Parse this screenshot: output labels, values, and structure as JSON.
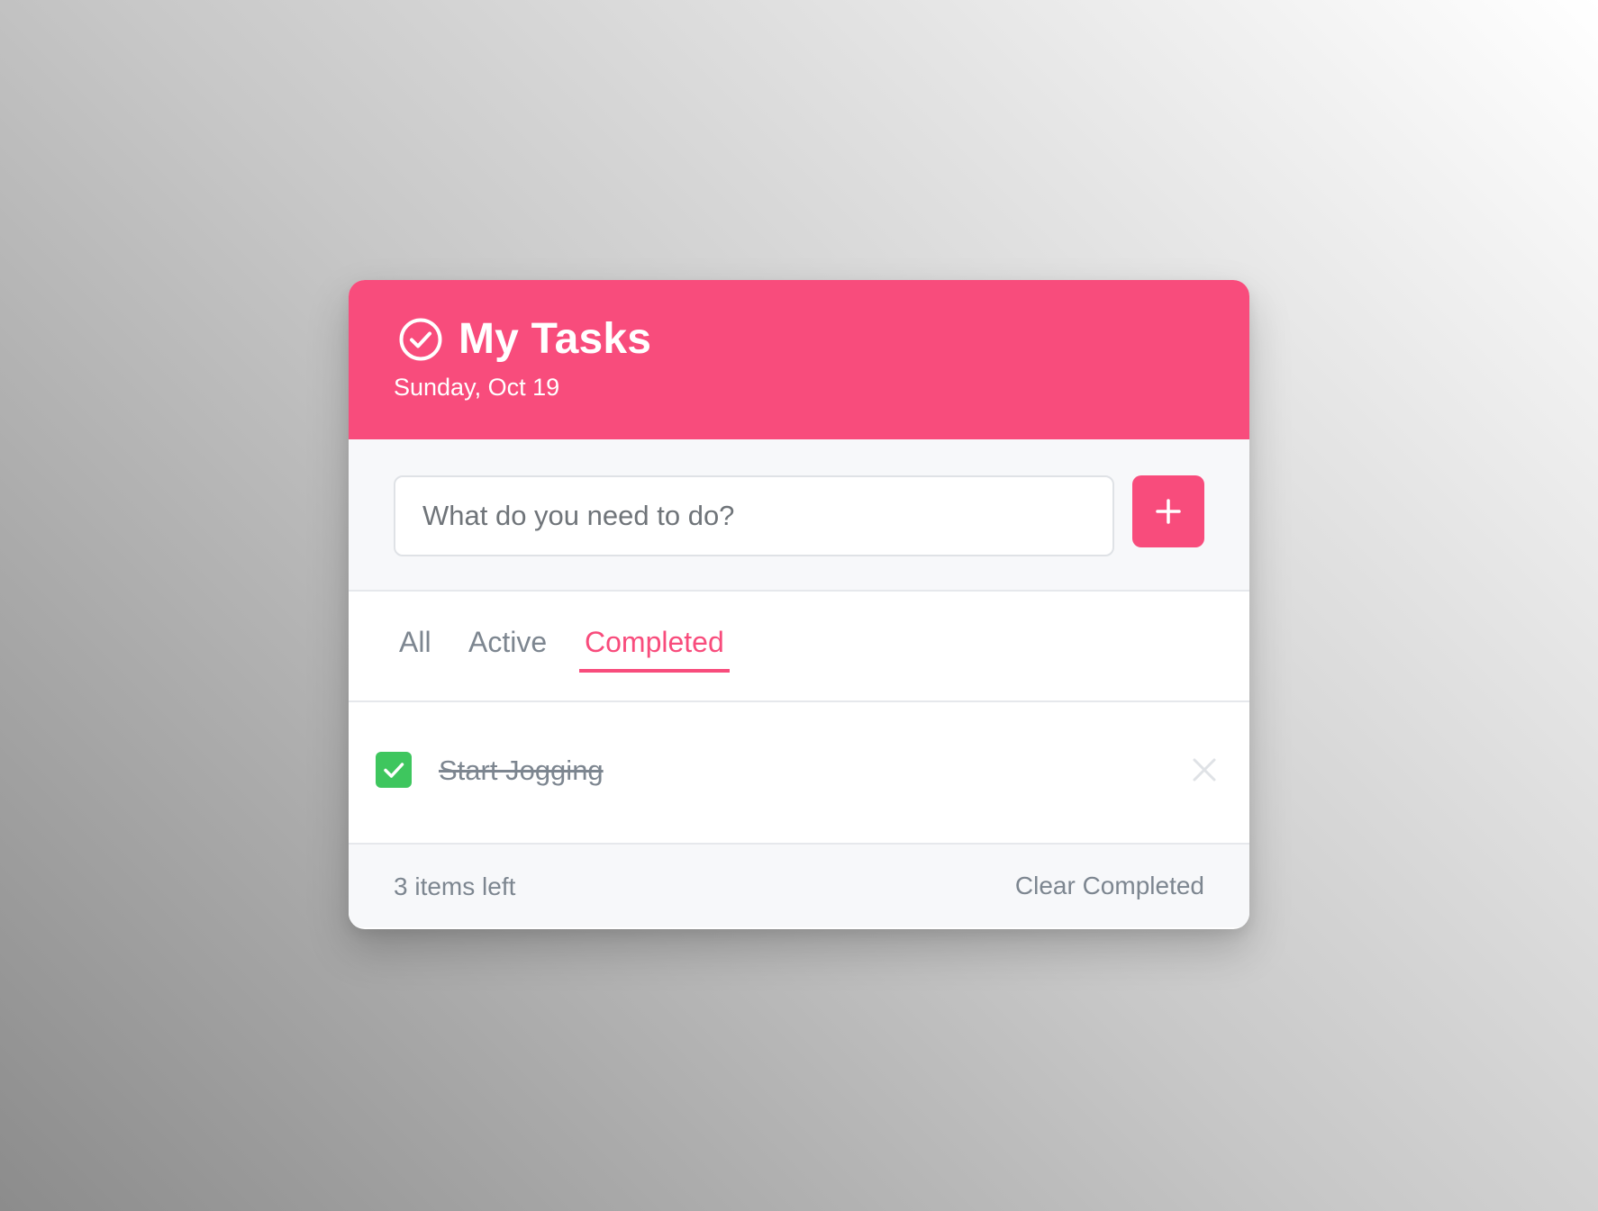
{
  "header": {
    "title": "My Tasks",
    "date": "Sunday, Oct 19",
    "icon": "check-circle-icon"
  },
  "add_task": {
    "placeholder": "What do you need to do?",
    "value": "",
    "button_label": "+"
  },
  "tabs": [
    {
      "label": "All",
      "active": false
    },
    {
      "label": "Active",
      "active": false
    },
    {
      "label": "Completed",
      "active": true
    }
  ],
  "todos": [
    {
      "text": "Start Jogging",
      "completed": true
    }
  ],
  "footer": {
    "items_left": "3 items left",
    "clear_label": "Clear Completed"
  },
  "colors": {
    "accent": "#f84c7c",
    "check": "#3ec65e",
    "muted_text": "#7d8690"
  }
}
